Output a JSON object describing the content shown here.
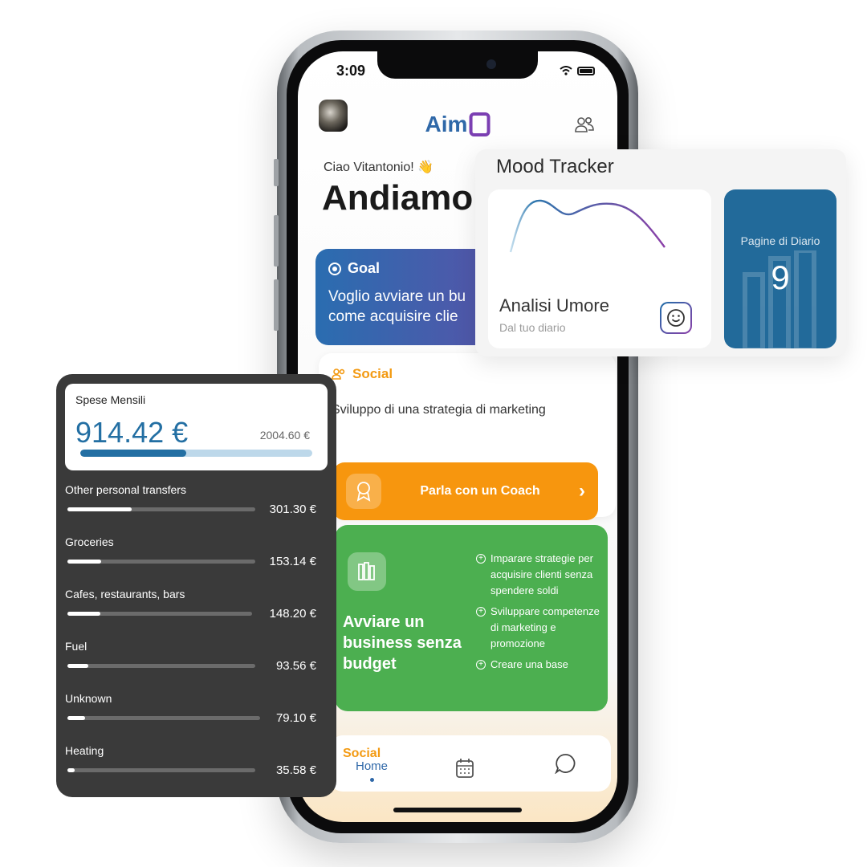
{
  "phone": {
    "status_time": "3:09",
    "logo_text": "Aim",
    "greeting": "Ciao Vitantonio! 👋",
    "headline": "Andiamo",
    "goal": {
      "title": "Goal",
      "text": "Voglio avviare un bu\ncome acquisire clie"
    },
    "social": {
      "title": "Social",
      "subtitle": "Sviluppo di una strategia di marketing",
      "coach_button": "Parla con un Coach"
    },
    "green_card": {
      "title": "Avviare un business senza budget",
      "items": [
        "Imparare strategie per acquisire clienti senza spendere soldi",
        "Sviluppare competenze di marketing e promozione",
        "Creare una base"
      ]
    },
    "next_card_title": "Social",
    "tabs": {
      "home": "Home"
    }
  },
  "mood_tracker": {
    "title": "Mood Tracker",
    "card_title": "Analisi Umore",
    "card_subtitle": "Dal tuo diario",
    "diary_label": "Pagine di Diario",
    "diary_count": "9"
  },
  "expenses": {
    "title": "Spese Mensili",
    "amount": "914.42 €",
    "total": "2004.60 €",
    "progress_fraction": 0.456,
    "items": [
      {
        "name": "Other personal transfers",
        "value": "301.30 €",
        "fraction": 0.34
      },
      {
        "name": "Groceries",
        "value": "153.14 €",
        "fraction": 0.18
      },
      {
        "name": "Cafes, restaurants, bars",
        "value": "148.20 €",
        "fraction": 0.18
      },
      {
        "name": "Fuel",
        "value": "93.56 €",
        "fraction": 0.11
      },
      {
        "name": "Unknown",
        "value": "79.10 €",
        "fraction": 0.09
      },
      {
        "name": "Heating",
        "value": "35.58 €",
        "fraction": 0.04
      }
    ]
  },
  "colors": {
    "brand_blue": "#236fa3",
    "brand_purple": "#7b3fb2",
    "orange": "#f7960e",
    "green": "#4caf50",
    "dark_panel": "#3a3a3a"
  }
}
